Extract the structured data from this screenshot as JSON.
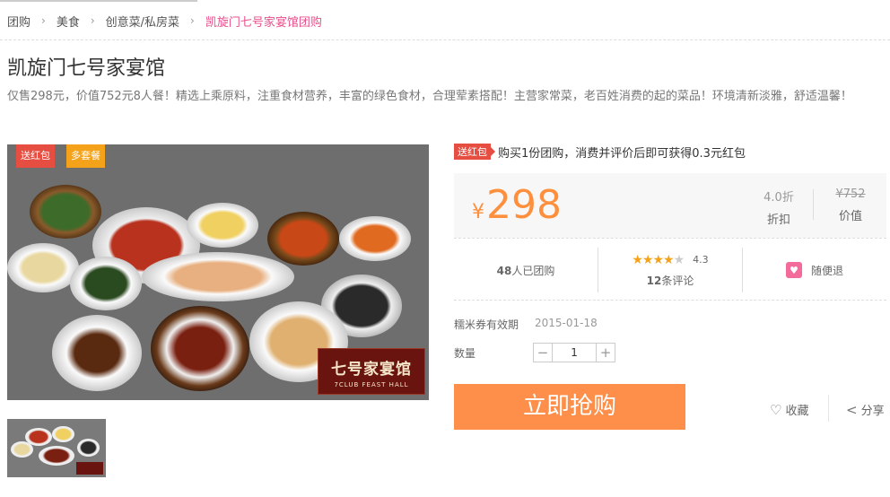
{
  "breadcrumb": {
    "items": [
      "团购",
      "美食",
      "创意菜/私房菜"
    ],
    "current": "凯旋门七号家宴馆团购"
  },
  "deal": {
    "title": "凯旋门七号家宴馆",
    "description": "仅售298元，价值752元8人餐！精选上乘原料，注重食材营养，丰富的绿色食材，合理荤素搭配！主营家常菜，老百姓消费的起的菜品！环境清新淡雅，舒适温馨！"
  },
  "gallery": {
    "tag_red": "送红包",
    "tag_orange": "多套餐",
    "logo_cn": "七号家宴馆",
    "logo_en": "7CLUB FEAST HALL"
  },
  "promo": {
    "badge": "送红包",
    "text": "购买1份团购，消费并评价后即可获得0.3元红包"
  },
  "price": {
    "currency": "¥",
    "amount": "298",
    "discount_value": "4.0折",
    "discount_label": "折扣",
    "original_value": "¥752",
    "original_label": "价值"
  },
  "stats": {
    "sold_count": "48",
    "sold_label": "人已团购",
    "stars_filled": 4,
    "stars_total": 5,
    "rating": "4.3",
    "review_count": "12",
    "review_label": "条评论",
    "refund_label": "随便退"
  },
  "validity": {
    "label": "糯米券有效期",
    "date": "2015-01-18"
  },
  "quantity": {
    "label": "数量",
    "value": "1",
    "minus": "−",
    "plus": "+"
  },
  "actions": {
    "buy": "立即抢购",
    "favorite": "收藏",
    "share": "分享"
  },
  "colors": {
    "accent": "#fd8f4a",
    "price": "#fd8f3d",
    "pink": "#e8508a",
    "badge_red": "#e64e42",
    "badge_orange": "#f5a21b"
  }
}
